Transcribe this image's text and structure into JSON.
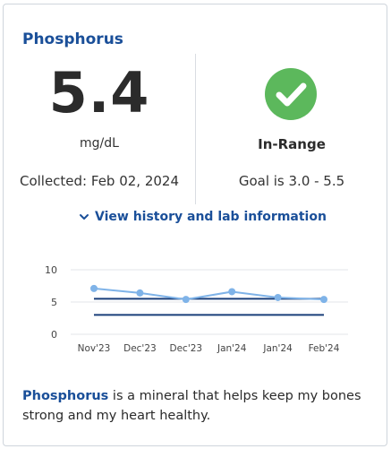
{
  "card": {
    "title": "Phosphorus",
    "value": "5.4",
    "unit": "mg/dL",
    "collected": "Collected: Feb 02, 2024",
    "status": "In-Range",
    "goal": "Goal is 3.0 - 5.5",
    "status_icon": "check-circle-icon",
    "status_color": "#5cb85c",
    "accent_color": "#1a4f99"
  },
  "history_link": {
    "label": "View history and lab information",
    "icon": "chevron-down-icon"
  },
  "chart_data": {
    "type": "line",
    "categories": [
      "Nov'23",
      "Dec'23",
      "Dec'23",
      "Jan'24",
      "Jan'24",
      "Feb'24"
    ],
    "series": [
      {
        "values": [
          7.1,
          6.4,
          5.4,
          6.6,
          5.7,
          5.4
        ],
        "color": "#7fb3e8"
      }
    ],
    "reference_lines": [
      {
        "values": [
          5.5,
          5.5
        ],
        "color": "#1a3f7a"
      },
      {
        "values": [
          3.0,
          3.0
        ],
        "color": "#1a3f7a"
      }
    ],
    "ylim": [
      0,
      10
    ],
    "yticks": [
      "10",
      "5",
      "0"
    ],
    "grid": true,
    "legend": "none"
  },
  "description": {
    "term": "Phosphorus",
    "text": " is a mineral that helps keep my bones strong and my heart healthy."
  }
}
